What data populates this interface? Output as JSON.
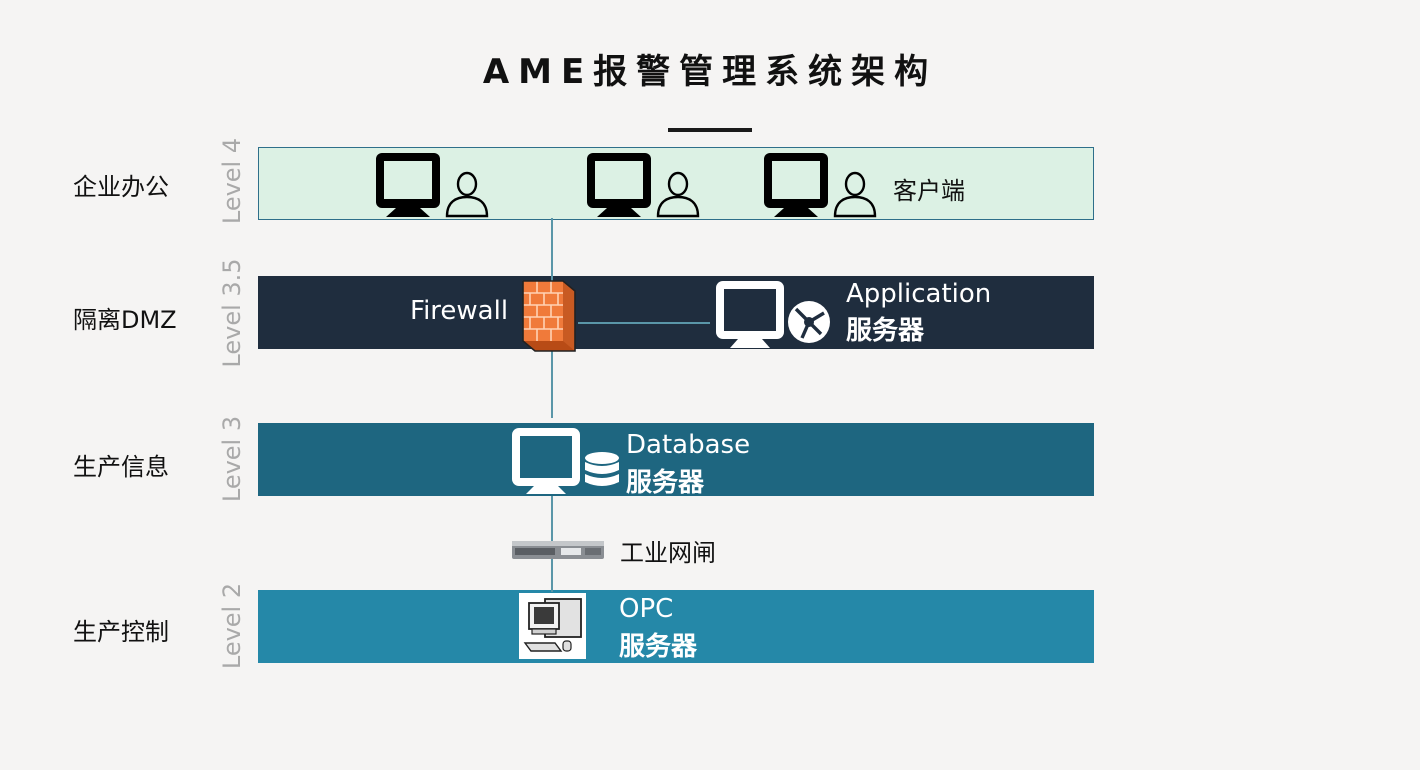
{
  "title": "AME报警管理系统架构",
  "levels": [
    {
      "row_label": "企业办公",
      "level_label": "Level 4"
    },
    {
      "row_label": "隔离DMZ",
      "level_label": "Level 3.5"
    },
    {
      "row_label": "生产信息",
      "level_label": "Level 3"
    },
    {
      "row_label": "生产控制",
      "level_label": "Level 2"
    }
  ],
  "level4": {
    "client_label": "客户端"
  },
  "level35": {
    "firewall_label": "Firewall",
    "app_name": "Application",
    "app_role": "服务器"
  },
  "level3": {
    "db_name": "Database",
    "db_role": "服务器"
  },
  "gateway": {
    "label": "工业网闸"
  },
  "level2": {
    "opc_name": "OPC",
    "opc_role": "服务器"
  },
  "colors": {
    "level4_band": "#dcf1e4",
    "level35_band": "#1f2d3e",
    "level3_band": "#1e6680",
    "level2_band": "#2588a8",
    "firewall": "#f07a3a",
    "connector": "#5a96a8"
  },
  "icons": [
    "monitor-icon",
    "user-icon",
    "firewall-icon",
    "network-globe-icon",
    "database-icon",
    "gateway-device-icon",
    "pc-workstation-icon"
  ]
}
